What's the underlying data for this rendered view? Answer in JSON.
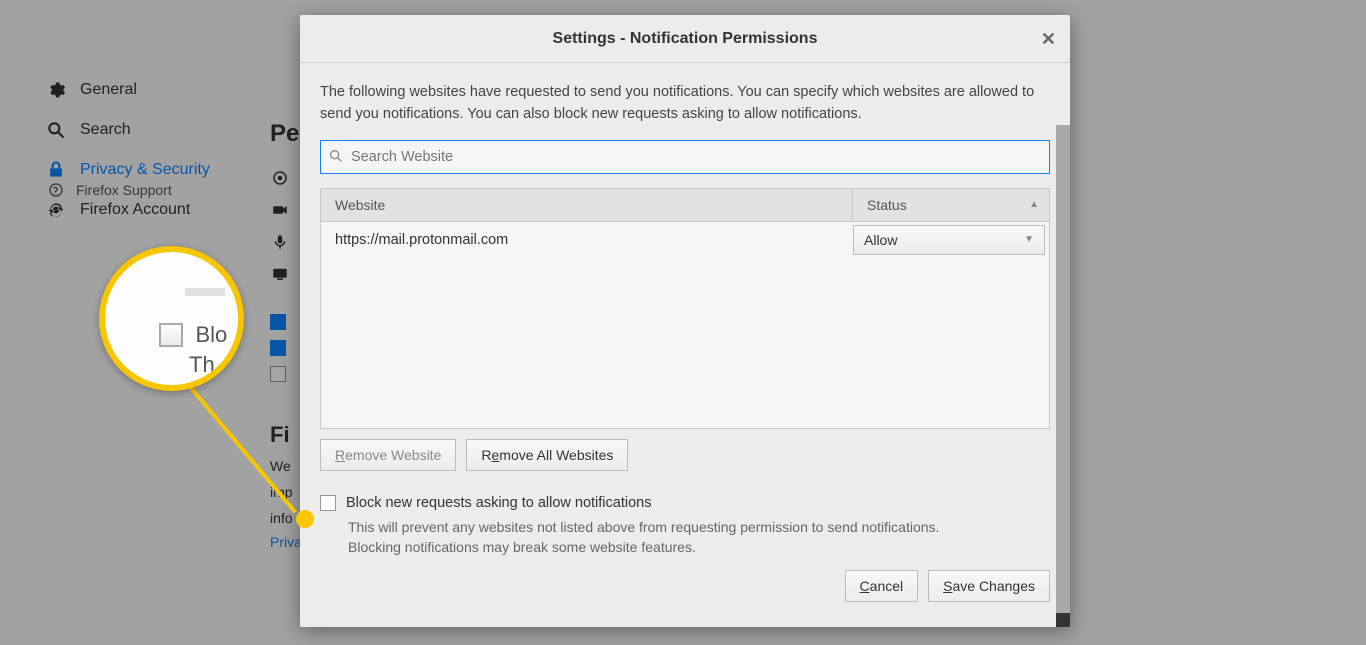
{
  "sidebar": {
    "items": [
      {
        "label": "General"
      },
      {
        "label": "Search"
      },
      {
        "label": "Privacy & Security"
      },
      {
        "label": "Firefox Account"
      }
    ],
    "support": "Firefox Support"
  },
  "background": {
    "permissions_heading": "Pe",
    "section_heading": "Fi",
    "body_line1": "We",
    "body_line2": "imp",
    "body_line3": "info",
    "privacy_link": "Privacy Notice"
  },
  "annotation": {
    "zoom_text1": "Blo",
    "zoom_text2": "Th"
  },
  "modal": {
    "title": "Settings - Notification Permissions",
    "description": "The following websites have requested to send you notifications. You can specify which websites are allowed to send you notifications. You can also block new requests asking to allow notifications.",
    "search_placeholder": "Search Website",
    "columns": {
      "website": "Website",
      "status": "Status"
    },
    "rows": [
      {
        "url": "https://mail.protonmail.com",
        "status": "Allow"
      }
    ],
    "remove_website": "Remove Website",
    "remove_all": "Remove All Websites",
    "block_label": "Block new requests asking to allow notifications",
    "block_hint": "This will prevent any websites not listed above from requesting permission to send notifications. Blocking notifications may break some website features.",
    "cancel": "Cancel",
    "save": "Save Changes"
  }
}
